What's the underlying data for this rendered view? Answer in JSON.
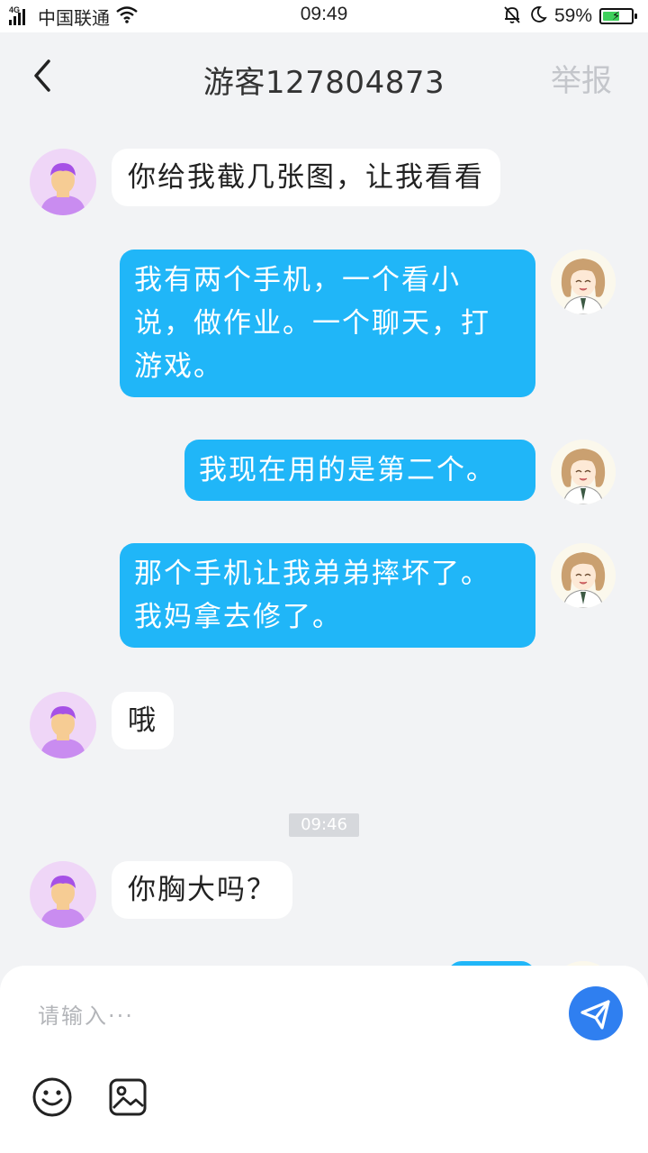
{
  "status_bar": {
    "network_type": "4G",
    "carrier": "中国联通",
    "time": "09:49",
    "battery_percent": "59%",
    "battery_level": 0.59,
    "icons": [
      "signal-icon",
      "wifi-icon",
      "mute-bell-icon",
      "moon-icon",
      "battery-charging-icon"
    ]
  },
  "header": {
    "title": "游客127804873",
    "report_label": "举报",
    "back_icon": "chevron-left-icon"
  },
  "messages": [
    {
      "from": "them",
      "text": "你给我截几张图，让我看看"
    },
    {
      "from": "me",
      "lines": [
        "我有两个手机，一个看小",
        "说，做作业。一个聊天，打",
        "游戏。"
      ]
    },
    {
      "from": "me",
      "lines": [
        "我现在用的是第二个。"
      ]
    },
    {
      "from": "me",
      "lines": [
        "那个手机让我弟弟摔坏了。",
        "我妈拿去修了。"
      ]
    },
    {
      "from": "them",
      "text": "哦"
    },
    {
      "from": "them",
      "text": "你胸大吗？"
    }
  ],
  "time_divider": "09:46",
  "input": {
    "placeholder": "请输入···",
    "value": ""
  },
  "colors": {
    "background": "#f2f3f5",
    "outgoing_bubble": "#20b6f8",
    "incoming_bubble": "#ffffff",
    "send_button": "#2f7ff0",
    "report_text": "#c4c6cb",
    "battery_fill": "#3ed05b"
  }
}
